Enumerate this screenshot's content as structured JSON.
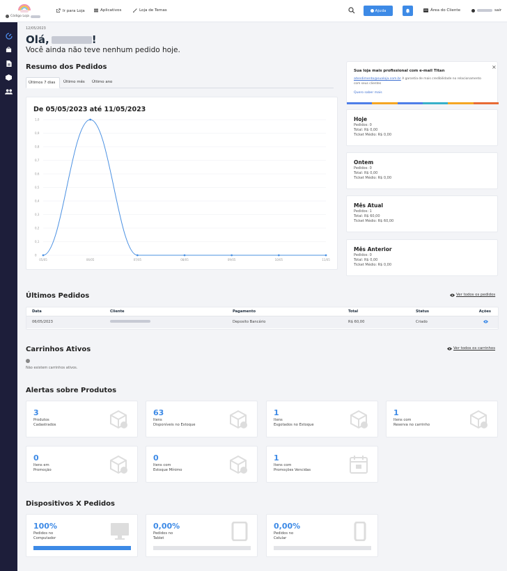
{
  "logo": {
    "code_label": "Código Loja"
  },
  "topbar": {
    "links": [
      "Ir para Loja",
      "Aplicativos",
      "Loja de Temas"
    ],
    "help": "Ajuda",
    "client_area": "Área do Cliente",
    "logout": "sair"
  },
  "header": {
    "date": "12/05/2023",
    "greeting_prefix": "Olá,",
    "greeting_suffix": "!",
    "subtitle": "Você ainda não teve nenhum pedido hoje."
  },
  "orders_summary": {
    "title": "Resumo dos Pedidos",
    "tabs": [
      "Últimos 7 dias",
      "Último mês",
      "Último ano"
    ],
    "chart_title": "De 05/05/2023 até 11/05/2023"
  },
  "chart_data": {
    "type": "line",
    "title": "De 05/05/2023 até 11/05/2023",
    "x": [
      "05/05",
      "06/05",
      "07/05",
      "08/05",
      "09/05",
      "10/05",
      "11/05"
    ],
    "series": [
      {
        "values": [
          0,
          1,
          0,
          0,
          0,
          0,
          0
        ]
      }
    ],
    "yticks": [
      "0",
      "0,1",
      "0,2",
      "0,3",
      "0,4",
      "0,5",
      "0,6",
      "0,7",
      "0,8",
      "0,9",
      "1,0"
    ],
    "ylim": [
      0,
      1
    ],
    "grid": true,
    "color": "#4a90e2"
  },
  "promo": {
    "title": "Sua loja mais profissional com e-mail Titan",
    "email": "atendimento@sualoja.com.br",
    "text": "A garantia de mais credibilidade no relacionamento com seus clientes",
    "link": "Quero saber mais",
    "close": "×"
  },
  "summaries": [
    {
      "title": "Hoje",
      "lines": [
        "Pedidos: 0",
        "Total: R$ 0,00",
        "Ticket Médio: R$ 0,00"
      ]
    },
    {
      "title": "Ontem",
      "lines": [
        "Pedidos: 0",
        "Total: R$ 0,00",
        "Ticket Médio: R$ 0,00"
      ]
    },
    {
      "title": "Mês Atual",
      "lines": [
        "Pedidos: 1",
        "Total: R$ 60,00",
        "Ticket Médio: R$ 60,00"
      ]
    },
    {
      "title": "Mês Anterior",
      "lines": [
        "Pedidos: 0",
        "Total: R$ 0,00",
        "Ticket Médio: R$ 0,00"
      ]
    }
  ],
  "latest_orders": {
    "title": "Últimos Pedidos",
    "view_all": "Ver todos os pedidos",
    "columns": [
      "Data",
      "Cliente",
      "Pagamento",
      "Total",
      "Status",
      "Ações"
    ],
    "rows": [
      {
        "date": "06/05/2023",
        "payment": "Deposito Bancário",
        "total": "R$ 60,00",
        "status": "Criado"
      }
    ]
  },
  "carts": {
    "title": "Carrinhos Ativos",
    "view_all": "Ver todos os carrinhos",
    "empty": "Não existem carrinhos ativos."
  },
  "alerts": {
    "title": "Alertas sobre Produtos",
    "items": [
      {
        "num": "3",
        "l1": "Produtos",
        "l2": "Cadastrados"
      },
      {
        "num": "63",
        "l1": "Itens",
        "l2": "Disponíveis no Estoque"
      },
      {
        "num": "1",
        "l1": "Itens",
        "l2": "Esgotados no Estoque"
      },
      {
        "num": "1",
        "l1": "Itens com",
        "l2": "Reserva no carrinho"
      },
      {
        "num": "0",
        "l1": "Itens em",
        "l2": "Promoção"
      },
      {
        "num": "0",
        "l1": "Itens com",
        "l2": "Estoque Mínimo"
      },
      {
        "num": "1",
        "l1": "Itens com",
        "l2": "Promoções Vencidas"
      }
    ]
  },
  "devices": {
    "title": "Dispositivos X Pedidos",
    "items": [
      {
        "pct": "100%",
        "l1": "Pedidos no",
        "l2": "Computador",
        "fill": 1.0
      },
      {
        "pct": "0,00%",
        "l1": "Pedidos no",
        "l2": "Tablet",
        "fill": 0.0
      },
      {
        "pct": "0,00%",
        "l1": "Pedidos no",
        "l2": "Celular",
        "fill": 0.0
      }
    ]
  },
  "colors": {
    "accent": "#3d8ae6",
    "sidebar": "#1d1e3a"
  }
}
